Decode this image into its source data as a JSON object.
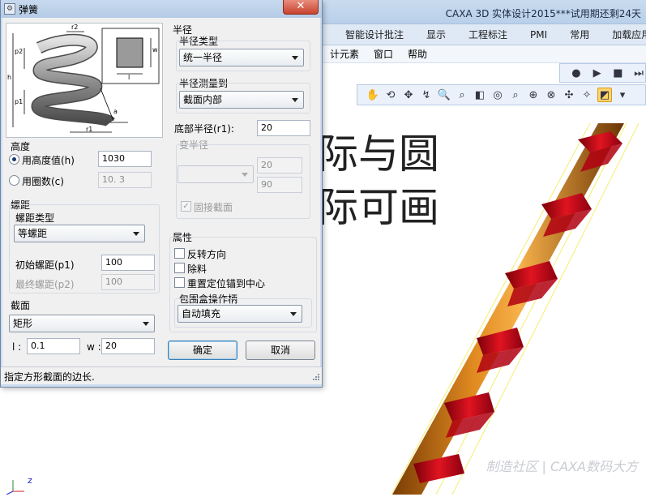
{
  "app": {
    "title": "CAXA 3D 实体设计2015***试用期还剩24天",
    "ribbon_tabs": [
      "智能设计批注",
      "显示",
      "工程标注",
      "PMI",
      "常用",
      "加载应用"
    ],
    "menu_items": [
      "计元素",
      "窗口",
      "帮助"
    ],
    "viewport_text_line1": "际与圆",
    "viewport_text_line2": "际可画",
    "watermark": "制造社区 | CAXA数码大方",
    "axis_label": "z"
  },
  "dialog": {
    "title": "弹簧",
    "close_glyph": "✕",
    "diagram_labels": {
      "r2": "r2",
      "p2": "p2",
      "h": "h",
      "p1": "p1",
      "r1": "r1",
      "a": "a",
      "w": "w",
      "l": "l"
    },
    "height": {
      "group_label": "高度",
      "by_height_label": "用高度值(h)",
      "by_height_value": "1030",
      "by_turns_label": "用圈数(c)",
      "by_turns_value": "10. 3"
    },
    "pitch": {
      "group_label": "螺距",
      "type_label": "螺距类型",
      "type_value": "等螺距",
      "initial_label": "初始螺距(p1)",
      "initial_value": "100",
      "final_label": "最终螺距(p2)",
      "final_value": "100"
    },
    "section": {
      "group_label": "截面",
      "type_value": "矩形",
      "l_label": "l :",
      "l_value": "0.1",
      "w_label": "w :",
      "w_value": "20"
    },
    "radius": {
      "group_label": "半径",
      "type_label": "半径类型",
      "type_value": "统一半径",
      "measure_label": "半径测量到",
      "measure_value": "截面内部",
      "bottom_label": "底部半径(r1):",
      "bottom_value": "20",
      "variable_label": "变半径",
      "variable_value1": "20",
      "variable_value2": "90",
      "fixed_section_label": "固接截面"
    },
    "properties": {
      "group_label": "属性",
      "reverse_label": "反转方向",
      "remove_label": "除料",
      "reanchor_label": "重置定位锚到中心",
      "bbox_group_label": "包围盒操作柄",
      "bbox_value": "自动填充"
    },
    "buttons": {
      "ok": "确定",
      "cancel": "取消"
    },
    "status": "指定方形截面的边长."
  }
}
